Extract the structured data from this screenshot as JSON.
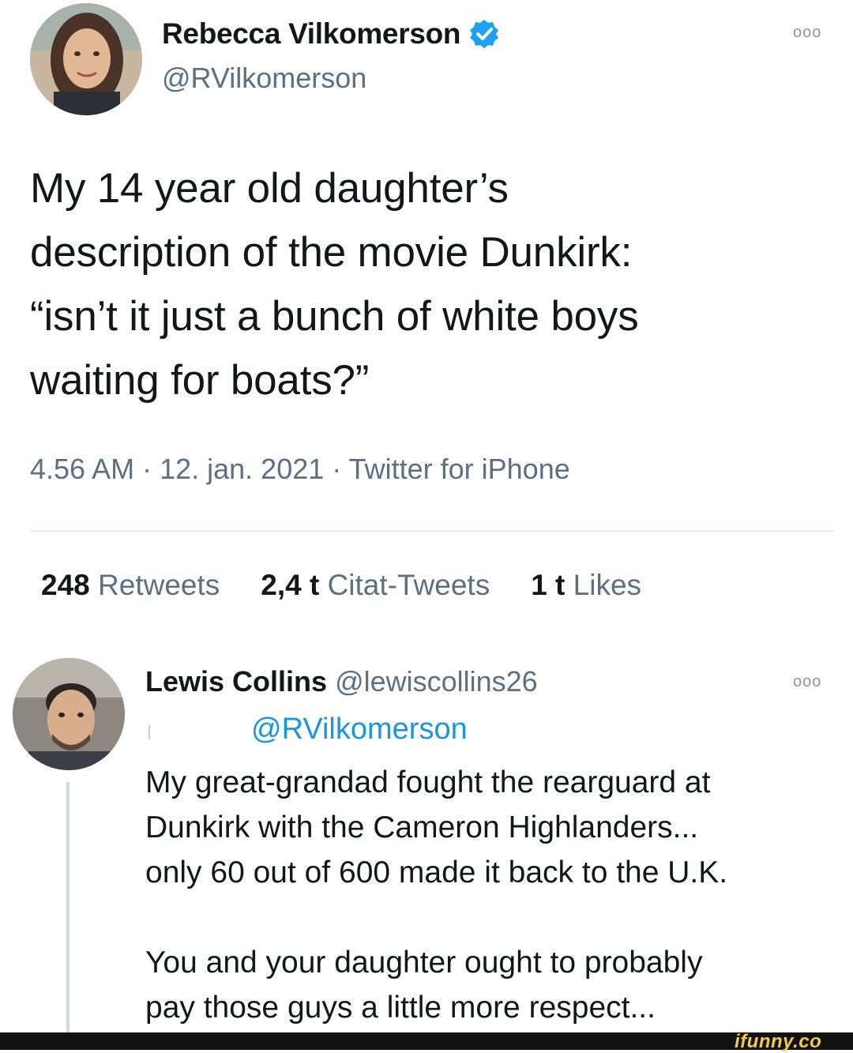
{
  "tweet": {
    "author_name": "Rebecca Vilkomerson",
    "author_handle": "@RVilkomerson",
    "more_label": "ooo",
    "text": "My 14 year old daughter’s\ndescription of the movie Dunkirk:\n“isn’t it just a bunch of white boys\nwaiting for boats?”",
    "time": "4.56 AM",
    "date": "12. jan. 2021",
    "source": "Twitter for iPhone",
    "sep": " · ",
    "stats": [
      {
        "num": "248",
        "label": "Retweets"
      },
      {
        "num": "2,4 t",
        "label": "Citat-Tweets"
      },
      {
        "num": "1 t",
        "label": "Likes"
      }
    ]
  },
  "reply": {
    "author_name": "Lewis Collins",
    "author_handle": "@lewiscollins26",
    "more_label": "ooo",
    "reply_to": "@RVilkomerson",
    "text": "My great-grandad fought the rearguard at\nDunkirk with the Cameron Highlanders...\nonly 60 out of 600 made it back to the U.K.\n\nYou and your daughter ought to probably\npay those guys a little more respect..."
  },
  "watermark": "ifunny.co",
  "colors": {
    "text": "#14171a",
    "secondary": "#5b7083",
    "accent": "#1b95e0",
    "verified": "#1da1f2"
  },
  "icons": {
    "verified": "verified-badge-icon",
    "more": "more-options-icon"
  }
}
